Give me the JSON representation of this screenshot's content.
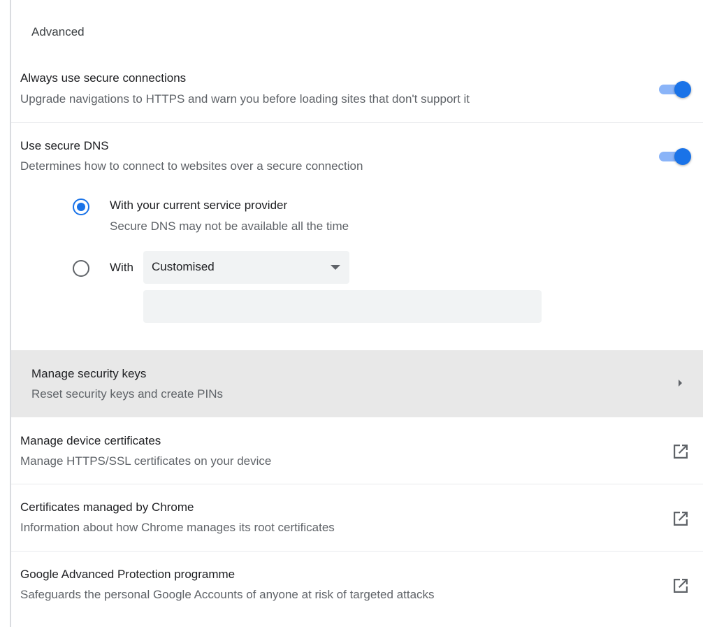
{
  "section": {
    "title": "Advanced"
  },
  "https_row": {
    "title": "Always use secure connections",
    "subtitle": "Upgrade navigations to HTTPS and warn you before loading sites that don't support it",
    "toggle_on": true
  },
  "dns_row": {
    "title": "Use secure DNS",
    "subtitle": "Determines how to connect to websites over a secure connection",
    "toggle_on": true,
    "option_current": {
      "label": "With your current service provider",
      "subtitle": "Secure DNS may not be available all the time",
      "selected": true
    },
    "option_custom": {
      "label": "With",
      "selected": false,
      "select_value": "Customised",
      "input_value": ""
    }
  },
  "security_keys_row": {
    "title": "Manage security keys",
    "subtitle": "Reset security keys and create PINs"
  },
  "device_certs_row": {
    "title": "Manage device certificates",
    "subtitle": "Manage HTTPS/SSL certificates on your device"
  },
  "chrome_certs_row": {
    "title": "Certificates managed by Chrome",
    "subtitle": "Information about how Chrome manages its root certificates"
  },
  "protection_row": {
    "title": "Google Advanced Protection programme",
    "subtitle": "Safeguards the personal Google Accounts of anyone at risk of targeted attacks"
  },
  "colors": {
    "accent": "#1a73e8",
    "toggle_track": "#8ab4f8",
    "hover_row": "#e8e8e8"
  },
  "icons": {
    "chevron": "chevron-right-icon",
    "external": "open-in-new-icon"
  }
}
